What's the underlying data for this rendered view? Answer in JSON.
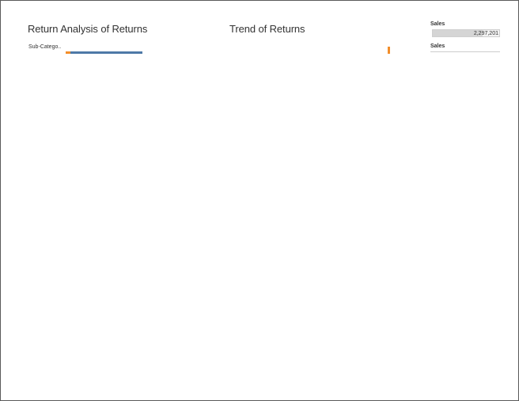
{
  "dashboard": {
    "title_left": "Return Analysis of Returns",
    "title_mid": "Trend of Returns",
    "subcategory_header": "Sub-Catego..",
    "sales_filter": {
      "label": "Sales",
      "value": "2,297,201",
      "fill_fraction": 0.75
    },
    "sales_legend": {
      "label": "Sales"
    },
    "colors": {
      "bar_blue": "#4e79a7",
      "bar_orange": "#f28e2b"
    }
  }
}
